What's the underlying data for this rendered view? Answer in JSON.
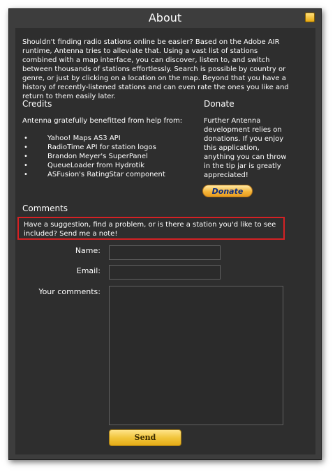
{
  "window": {
    "title": "About"
  },
  "intro": "Shouldn't finding radio stations online be easier? Based on the Adobe AIR runtime, Antenna tries to alleviate that. Using a vast list of stations combined with a map interface, you can discover, listen to, and switch between thousands of stations effortlessly. Search is possible by country or genre, or just by clicking on a location on the map. Beyond that you have a history of recently-listened stations and can even rate the ones you like and return to them easily later.",
  "credits": {
    "heading": "Credits",
    "intro": "Antenna gratefully benefitted from help from:",
    "bullet": "•",
    "items": [
      "Yahoo! Maps AS3 API",
      "RadioTime API for station logos",
      "Brandon Meyer's SuperPanel",
      "QueueLoader from Hydrotik",
      "ASFusion's RatingStar component"
    ]
  },
  "donate": {
    "heading": "Donate",
    "text": "Further Antenna development relies on donations. If you enjoy this application, anything you can throw in the tip jar is greatly appreciated!",
    "button_label": "Donate"
  },
  "comments": {
    "heading": "Comments",
    "prompt": "Have a suggestion, find a problem, or is there a station you'd like to see included? Send me a note!",
    "name_label": "Name:",
    "email_label": "Email:",
    "comments_label": "Your comments:",
    "name_value": "",
    "email_value": "",
    "comments_value": "",
    "send_label": "Send"
  },
  "colors": {
    "window_bg": "#3d3d3d",
    "content_bg": "#2e2e2e",
    "highlight_border": "#d52124",
    "button_gold": "#f1c53c",
    "donate_text": "#0b2b80"
  }
}
